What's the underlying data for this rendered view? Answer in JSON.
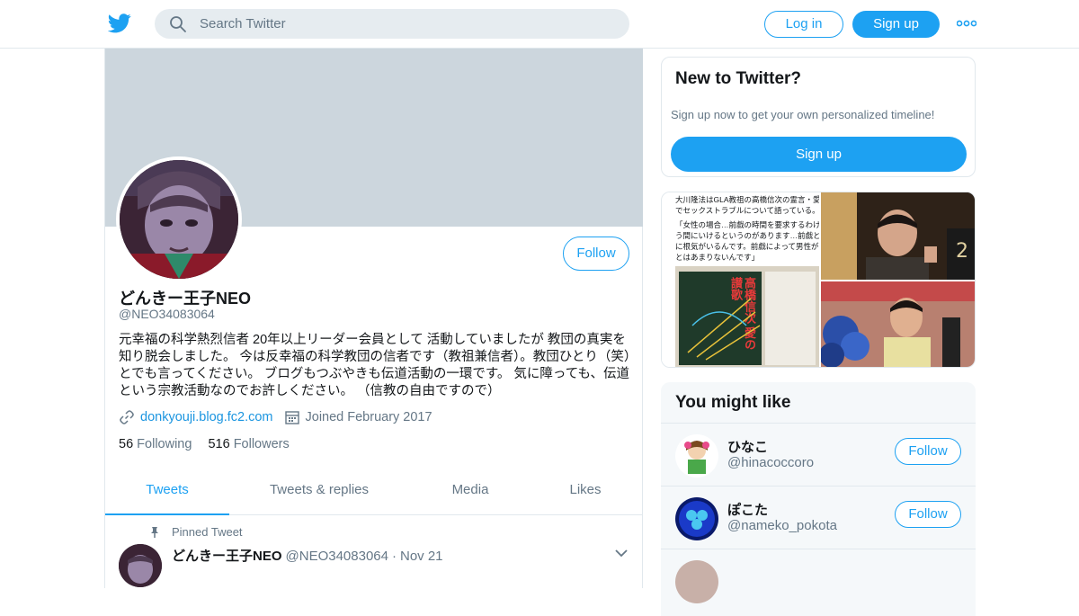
{
  "topbar": {
    "search_placeholder": "Search Twitter",
    "login_label": "Log in",
    "signup_label": "Sign up"
  },
  "profile": {
    "name": "どんきー王子NEO",
    "handle": "@NEO34083064",
    "follow_label": "Follow",
    "bio": "元幸福の科学熱烈信者 20年以上リーダー会員として 活動していましたが 教団の真実を知り脱会しました。 今は反幸福の科学教団の信者です（教祖兼信者）。教団ひとり（笑）とでも言ってください。 ブログもつぶやきも伝道活動の一環です。 気に障っても、伝道という宗教活動なのでお許しください。 （信教の自由ですので）",
    "website": "donkyouji.blog.fc2.com",
    "joined": "Joined February 2017",
    "following_count": "56",
    "following_label": "Following",
    "followers_count": "516",
    "followers_label": "Followers"
  },
  "tabs": [
    "Tweets",
    "Tweets & replies",
    "Media",
    "Likes"
  ],
  "pinned_tweet": {
    "pinned_label": "Pinned Tweet",
    "name": "どんきー王子NEO",
    "handle": "@NEO34083064",
    "separator": "·",
    "date": "Nov 21"
  },
  "new_to_twitter": {
    "title": "New to Twitter?",
    "subtitle": "Sign up now to get your own personalized timeline!",
    "signup_label": "Sign up"
  },
  "media_text": {
    "line1": "大川隆法はGLA教祖の高橋信次の霊言・愛",
    "line2": "でセックストラブルについて語っている。",
    "line3": "「女性の場合…前戯の時間を要求するわけ",
    "line4": "う間にいけるというのがあります…前戯と",
    "line5": "に根気がいるんです。前戯によって男性が",
    "line6": "とはあまりないんです」",
    "book_title": "高橋信次 愛の讃歌"
  },
  "you_might_like": {
    "title": "You might like",
    "users": [
      {
        "name": "ひなこ",
        "handle": "@hinacoccoro",
        "follow_label": "Follow"
      },
      {
        "name": "ぽこた",
        "handle": "@nameko_pokota",
        "follow_label": "Follow"
      }
    ]
  },
  "colors": {
    "brand": "#1da1f2",
    "banner": "#ccd6dd",
    "secondary_text": "#657786"
  }
}
